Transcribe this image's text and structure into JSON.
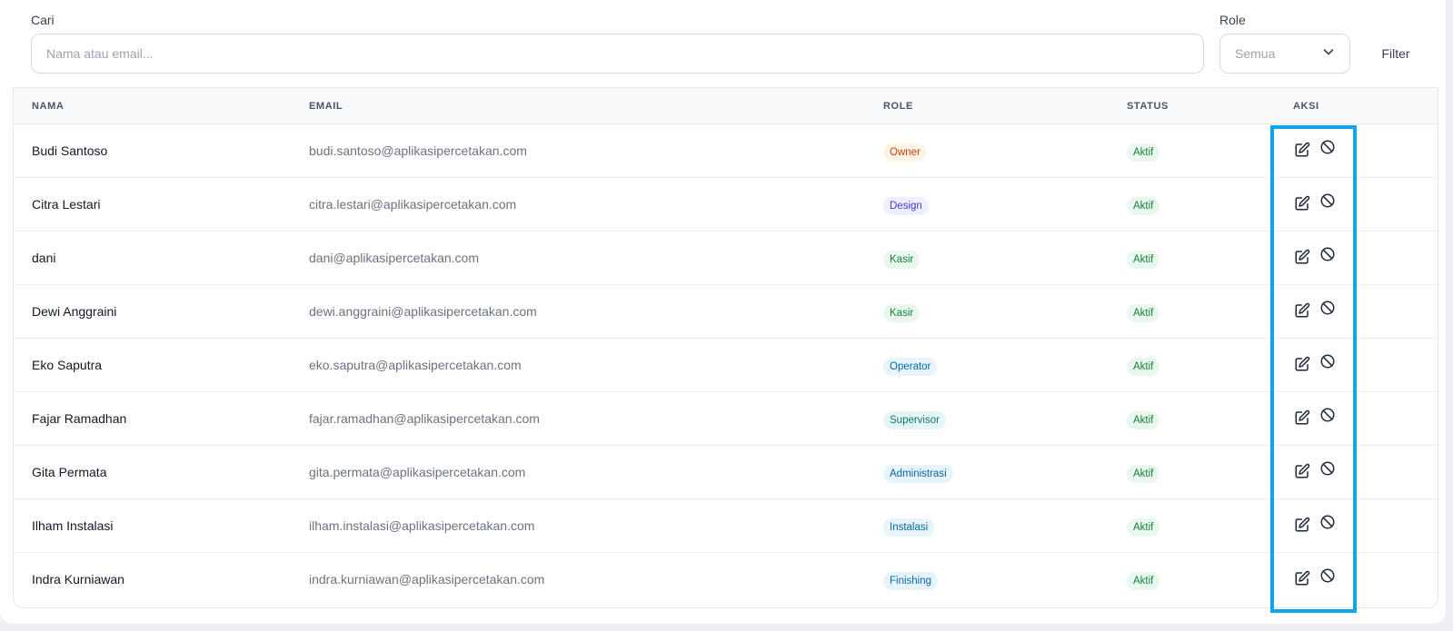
{
  "filters": {
    "search_label": "Cari",
    "search_placeholder": "Nama atau email...",
    "role_label": "Role",
    "role_value": "Semua",
    "filter_button": "Filter"
  },
  "table": {
    "headers": {
      "name": "NAMA",
      "email": "EMAIL",
      "role": "ROLE",
      "status": "STATUS",
      "actions": "AKSI"
    },
    "rows": [
      {
        "name": "Budi Santoso",
        "email": "budi.santoso@aplikasipercetakan.com",
        "role": "Owner",
        "status": "Aktif"
      },
      {
        "name": "Citra Lestari",
        "email": "citra.lestari@aplikasipercetakan.com",
        "role": "Design",
        "status": "Aktif"
      },
      {
        "name": "dani",
        "email": "dani@aplikasipercetakan.com",
        "role": "Kasir",
        "status": "Aktif"
      },
      {
        "name": "Dewi Anggraini",
        "email": "dewi.anggraini@aplikasipercetakan.com",
        "role": "Kasir",
        "status": "Aktif"
      },
      {
        "name": "Eko Saputra",
        "email": "eko.saputra@aplikasipercetakan.com",
        "role": "Operator",
        "status": "Aktif"
      },
      {
        "name": "Fajar Ramadhan",
        "email": "fajar.ramadhan@aplikasipercetakan.com",
        "role": "Supervisor",
        "status": "Aktif"
      },
      {
        "name": "Gita Permata",
        "email": "gita.permata@aplikasipercetakan.com",
        "role": "Administrasi",
        "status": "Aktif"
      },
      {
        "name": "Ilham Instalasi",
        "email": "ilham.instalasi@aplikasipercetakan.com",
        "role": "Instalasi",
        "status": "Aktif"
      },
      {
        "name": "Indra Kurniawan",
        "email": "indra.kurniawan@aplikasipercetakan.com",
        "role": "Finishing",
        "status": "Aktif"
      }
    ]
  },
  "role_colors": {
    "Owner": {
      "fg": "#c2410c",
      "bg": "#fff4e5"
    },
    "Design": {
      "fg": "#4338ca",
      "bg": "#eef0fd"
    },
    "Kasir": {
      "fg": "#15803d",
      "bg": "#eaf7ee"
    },
    "Operator": {
      "fg": "#0369a1",
      "bg": "#e8f4fc"
    },
    "Supervisor": {
      "fg": "#0f766e",
      "bg": "#e6f6f4"
    },
    "Administrasi": {
      "fg": "#0369a1",
      "bg": "#e8f4fc"
    },
    "Instalasi": {
      "fg": "#0369a1",
      "bg": "#e8f4fc"
    },
    "Finishing": {
      "fg": "#0369a1",
      "bg": "#e8f4fc"
    }
  },
  "icons": {
    "edit": "edit-icon",
    "deactivate": "block-icon",
    "dropdown": "chevron-down-icon"
  },
  "highlight_color": "#0ea5e9"
}
